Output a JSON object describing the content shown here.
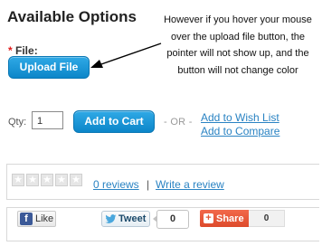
{
  "section_title": "Available Options",
  "file_field": {
    "required_marker": "*",
    "label": "File:",
    "upload_button": "Upload File"
  },
  "annotation": {
    "text": "However if you hover your mouse over the upload file button, the pointer will not show up, and the button will not change color"
  },
  "purchase": {
    "qty_label": "Qty:",
    "qty_value": "1",
    "add_to_cart": "Add to Cart",
    "or_text": "- OR -",
    "wish_list": "Add to Wish List",
    "compare": "Add to Compare"
  },
  "reviews": {
    "rating": 0,
    "max_rating": 5,
    "reviews_link": "0 reviews",
    "separator": "|",
    "write_review": "Write a review"
  },
  "social": {
    "fb_icon": "f",
    "fb_like": "Like",
    "tweet": "Tweet",
    "tweet_count": "0",
    "share_icon": "+",
    "share": "Share",
    "share_count": "0"
  },
  "colors": {
    "button_blue": "#1a97d9",
    "link": "#2a83c3",
    "share_orange": "#e8573a",
    "facebook": "#3b5998"
  }
}
